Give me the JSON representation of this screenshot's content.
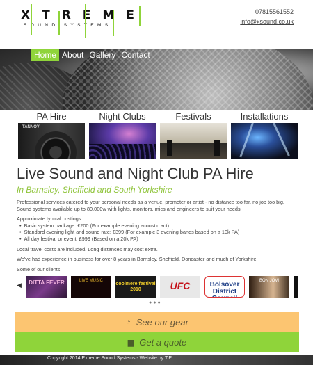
{
  "header": {
    "logo_main": "XTREME",
    "logo_sub": "SOUND SYSTEMS",
    "phone": "07815561552",
    "email": "info@xsound.co.uk"
  },
  "nav": {
    "items": [
      "Home",
      "About",
      "Gallery",
      "Contact"
    ],
    "active": "Home"
  },
  "categories": [
    {
      "label": "PA Hire"
    },
    {
      "label": "Night Clubs"
    },
    {
      "label": "Festivals"
    },
    {
      "label": "Installations"
    }
  ],
  "pa_brand": "TANNOY",
  "main": {
    "title": "Live Sound and Night Club PA Hire",
    "subtitle": "In Barnsley, Sheffield and South Yorkshire",
    "intro": "Professional services catered to your personal needs as a venue, promoter or artist - no distance too far, no job too big. Sound systems available up to 80,000w with lights, monitors, mics and engineers to suit your needs.",
    "costings_heading": "Approximate typical costings:",
    "costings": [
      "Basic system package: £200 (For example evening acoustic act)",
      "Standard evening light and sound rate: £399 (For example 3 evening bands based on a 10k PA)",
      "All day festival or event: £999 (Based on a 20k PA)"
    ],
    "travel": "Local travel costs are included. Long distances may cost extra.",
    "experience": "We've had experience in business for over 8 years in Barnsley, Sheffield, Doncaster and much of Yorkshire.",
    "clients_heading": "Some of our clients:"
  },
  "clients": [
    {
      "label": "DITTA FEVER"
    },
    {
      "label": "LIVE MUSIC"
    },
    {
      "label": "coolmere festival 2010"
    },
    {
      "label": "UFC"
    },
    {
      "label": "Bolsover District Council"
    },
    {
      "label": "BON JOVI"
    }
  ],
  "carousel": {
    "prev": "◀",
    "dots": "●●●"
  },
  "buttons": {
    "gear": "See our gear",
    "quote": "Get a quote"
  },
  "footer": {
    "copyright": "Copyright 2014 Extreme Sound Systems - Website by T.E."
  },
  "colors": {
    "accent_green": "#8fd43a",
    "gear_orange": "#fcc571"
  }
}
